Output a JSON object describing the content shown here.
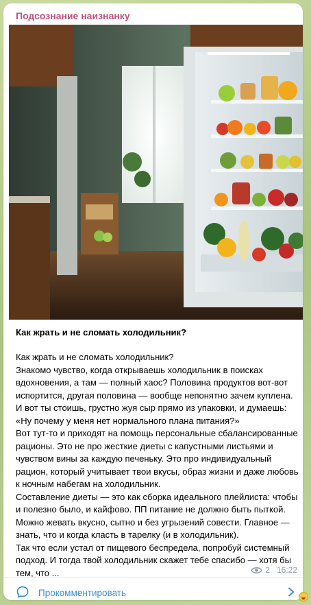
{
  "channel": {
    "name": "Подсознание наизнанку"
  },
  "post": {
    "title": "Как жрать и не сломать холодильник?",
    "body": "Как жрать и не сломать холодильник?\nЗнакомо чувство, когда открываешь холодильник в поисках вдохновения, а там — полный хаос? Половина продуктов вот-вот испортится, другая половина — вообще непонятно зачем куплена. И вот ты стоишь, грустно жуя сыр прямо из упаковки, и думаешь: «Ну почему у меня нет нормального плана питания?»\nВот тут-то и приходят на помощь персональные сбалансированные рационы. Это не про жесткие диеты с капустными листьями и чувством вины за каждую печеньку. Это про индивидуальный рацион, который учитывает твои вкусы, образ жизни и даже любовь к ночным набегам на холодильник.\nСоставление диеты — это как сборка идеального плейлиста: чтобы и полезно было, и кайфово. ПП питание не должно быть пыткой. Можно жевать вкусно, сытно и без угрызений совести. Главное — знать, что и когда класть в тарелку (и в холодильник).\nТак что если устал от пищевого беспредела, попробуй системный подход. И тогда твой холодильник скажет тебе спасибо — хотя бы тем, что ...",
    "views": "2",
    "time": "16:22"
  },
  "comments": {
    "label": "Прокомментировать"
  },
  "icons": {
    "views": "eye-icon",
    "comment": "comment-bubble-icon",
    "chevron": "chevron-right-icon",
    "emoji": "emoji-icon"
  },
  "colors": {
    "channel_name": "#c2507a",
    "link": "#3a8fd1",
    "meta": "#8d9ba5",
    "background": "#b9cf93"
  }
}
